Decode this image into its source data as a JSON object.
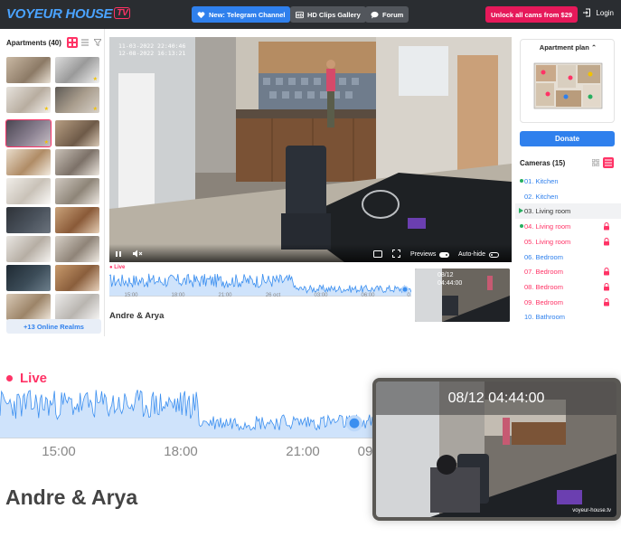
{
  "topbar": {
    "logo": "VOYEUR HOUSE",
    "logo_badge": "TV",
    "telegram_label": "New: Telegram Channel",
    "clips_label": "HD Clips Gallery",
    "forum_label": "Forum",
    "unlock_label": "Unlock all cams from $29",
    "login_label": "Login"
  },
  "sidebar": {
    "title": "Apartments (40)",
    "realms_label": "+13 Online Realms"
  },
  "video": {
    "timestamp_line1": "11-03-2022 22:40:46",
    "timestamp_line2": "12-08-2022 16:13:21",
    "previews_label": "Previews",
    "autohide_label": "Auto-hide",
    "previews_on": true,
    "autohide_on": false
  },
  "timeline": {
    "live_label": "Live",
    "ticks": [
      "15:00",
      "18:00",
      "21:00",
      "26 oct",
      "03:00",
      "06:00",
      "0"
    ],
    "preview_time_line1": "08/12",
    "preview_time_line2": "04:44:00",
    "couple_name": "Andre & Arya"
  },
  "right": {
    "plan_title": "Apartment plan",
    "donate_label": "Donate",
    "cameras_title": "Cameras (15)",
    "cameras": [
      {
        "label": "01. Kitchen",
        "color": "#2f80ed",
        "status": "dot",
        "locked": false,
        "active": false
      },
      {
        "label": "02. Kitchen",
        "color": "#2f80ed",
        "status": "",
        "locked": false,
        "active": false
      },
      {
        "label": "03. Living room",
        "color": "#333333",
        "status": "play",
        "locked": false,
        "active": true
      },
      {
        "label": "04. Living room",
        "color": "#ff3366",
        "status": "dot",
        "locked": true,
        "active": false
      },
      {
        "label": "05. Living room",
        "color": "#ff3366",
        "status": "",
        "locked": true,
        "active": false
      },
      {
        "label": "06. Bedroom",
        "color": "#2f80ed",
        "status": "",
        "locked": false,
        "active": false
      },
      {
        "label": "07. Bedroom",
        "color": "#ff3366",
        "status": "",
        "locked": true,
        "active": false
      },
      {
        "label": "08. Bedroom",
        "color": "#ff3366",
        "status": "",
        "locked": true,
        "active": false
      },
      {
        "label": "09. Bedroom",
        "color": "#ff3366",
        "status": "",
        "locked": true,
        "active": false
      },
      {
        "label": "10. Bathroom",
        "color": "#2f80ed",
        "status": "",
        "locked": false,
        "active": false
      }
    ]
  },
  "zoom": {
    "live_label": "Live",
    "ticks": [
      "15:00",
      "18:00",
      "21:00",
      "09"
    ],
    "preview_time": "08/12 04:44:00",
    "watermark": "voyeur-house.tv",
    "couple_name": "Andre & Arya"
  },
  "colors": {
    "accent_blue": "#2f80ed",
    "accent_pink": "#ff3366",
    "topbar_bg": "#2a2d31"
  }
}
